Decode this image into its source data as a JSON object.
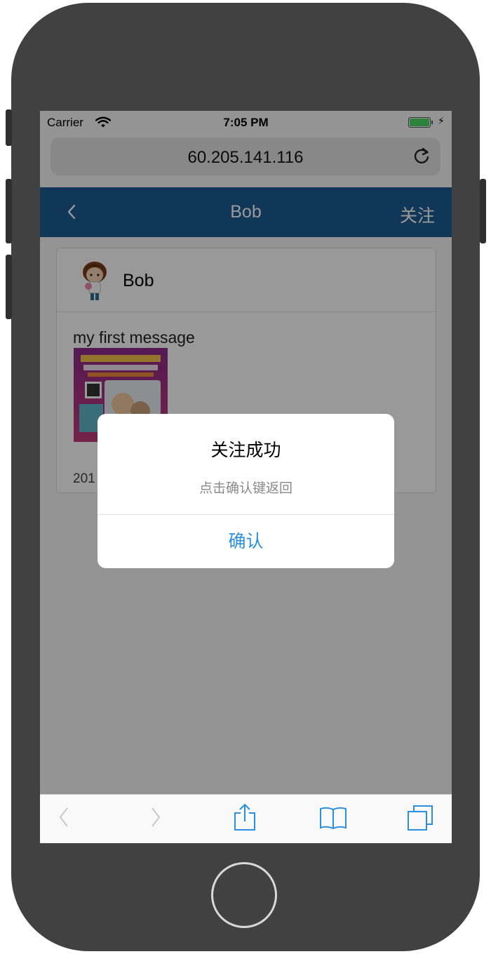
{
  "status_bar": {
    "carrier": "Carrier",
    "time": "7:05 PM"
  },
  "browser": {
    "url": "60.205.141.116"
  },
  "app": {
    "title": "Bob",
    "follow_label": "关注"
  },
  "post": {
    "author": "Bob",
    "message": "my first message",
    "date": "201"
  },
  "dialog": {
    "title": "关注成功",
    "message": "点击确认键返回",
    "confirm_label": "确认"
  },
  "colors": {
    "navbar": "#1b5c93",
    "accent": "#2a8fe0"
  },
  "icons": [
    "wifi-icon",
    "battery-icon",
    "charging-bolt-icon",
    "reload-icon",
    "back-chevron-icon",
    "toolbar-back-icon",
    "toolbar-forward-icon",
    "share-icon",
    "bookmarks-icon",
    "tabs-icon"
  ]
}
